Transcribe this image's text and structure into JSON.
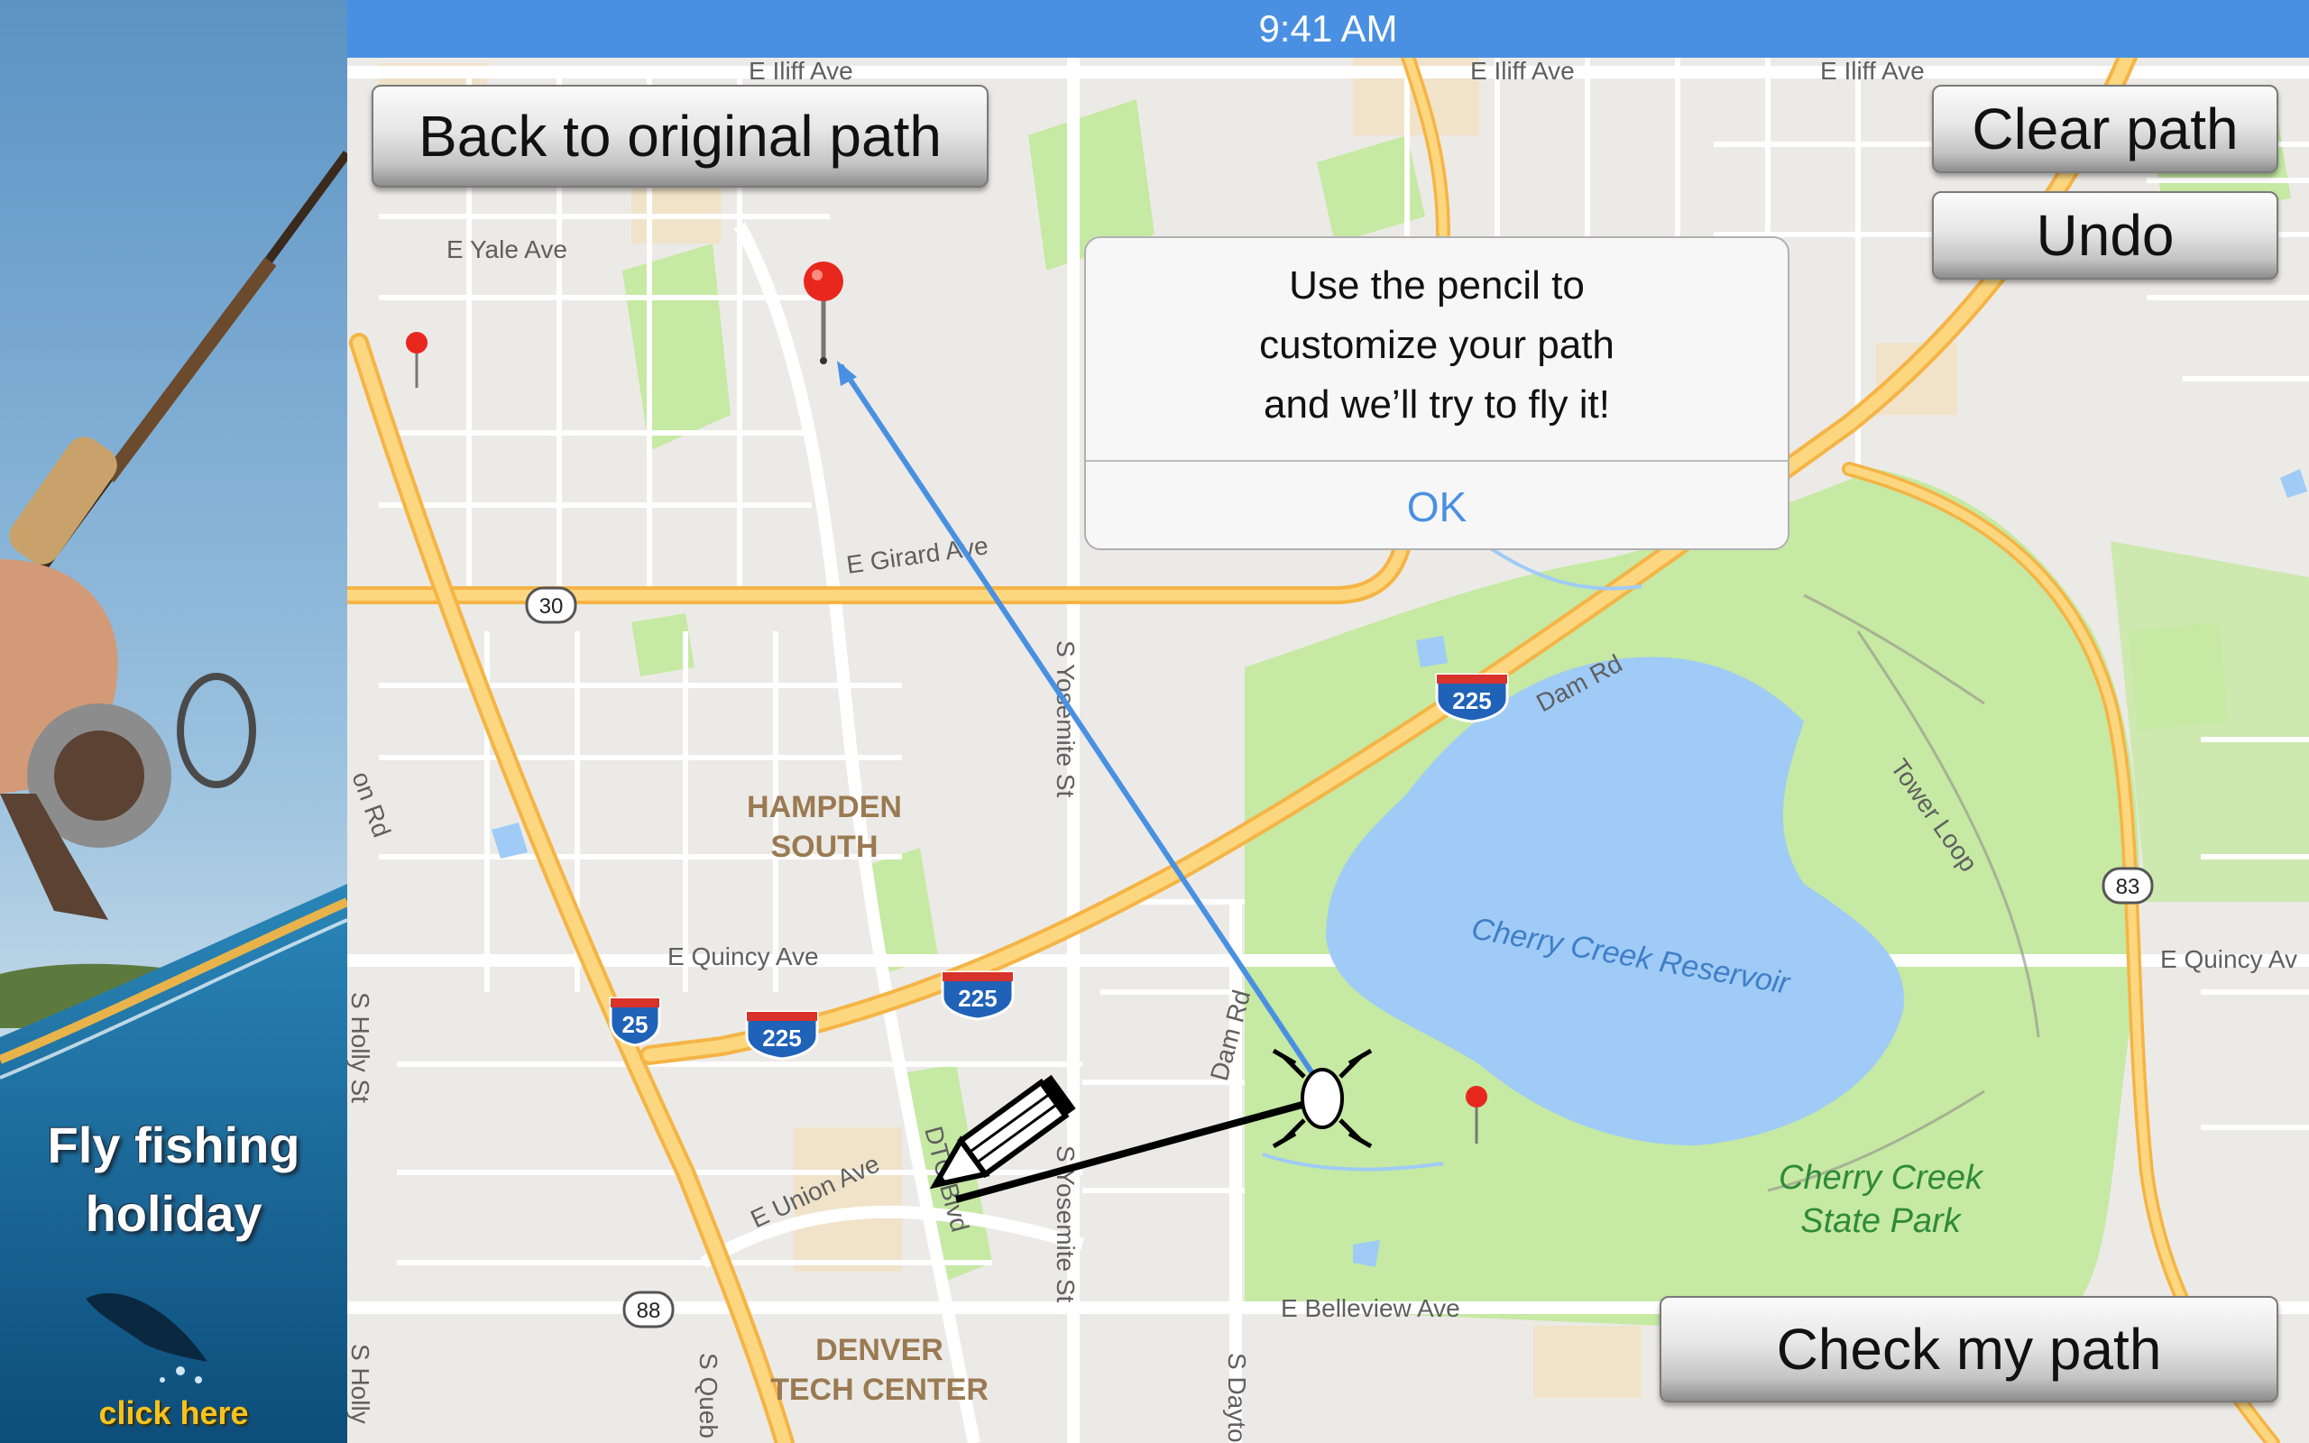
{
  "status_bar": {
    "time": "9:41 AM"
  },
  "ad": {
    "title_line1": "Fly fishing",
    "title_line2": "holiday",
    "cta": "click here"
  },
  "toolbar": {
    "back_label": "Back to original path",
    "clear_label": "Clear path",
    "undo_label": "Undo",
    "check_label": "Check my path"
  },
  "alert": {
    "line1": "Use the pencil to",
    "line2": "customize your path",
    "line3": "and we’ll try to fly it!",
    "ok_label": "OK"
  },
  "map": {
    "streets": {
      "iliff_left": "E Iliff Ave",
      "iliff_mid": "E Iliff Ave",
      "iliff_right": "E Iliff Ave",
      "yale": "E Yale Ave",
      "girard": "E Girard Ave",
      "quincy": "E Quincy Ave",
      "quincy_right": "E Quincy Av",
      "union": "E Union Ave",
      "belleview": "E Belleview Ave",
      "yosemite_north": "S Yosemite St",
      "yosemite_south": "S Yosemite St",
      "holly": "S Holly St",
      "holly_south": "S Holly",
      "dam_rd_north": "Dam Rd",
      "dam_rd_west": "Dam Rd",
      "tower_loop": "Tower Loop",
      "dtc_blvd": "DTC Blvd",
      "quebec": "S Queb",
      "dayton": "S Dayto",
      "on_rd": "on Rd"
    },
    "areas": {
      "hampden_line1": "HAMPDEN",
      "hampden_line2": "SOUTH",
      "dtc_line1": "DENVER",
      "dtc_line2": "TECH CENTER",
      "reservoir": "Cherry Creek Reservoir",
      "park_line1": "Cherry Creek",
      "park_line2": "State Park"
    },
    "shields": {
      "i225_north": "225",
      "i225_south": "225",
      "i225_west": "225",
      "i25": "25",
      "r30": "30",
      "r83": "83",
      "r88": "88"
    },
    "colors": {
      "water": "#9fcbf6",
      "park": "#c6e9a3",
      "highway": "#f7c35c",
      "path_blue": "#4a90e2",
      "pin_red": "#e8281e"
    }
  }
}
